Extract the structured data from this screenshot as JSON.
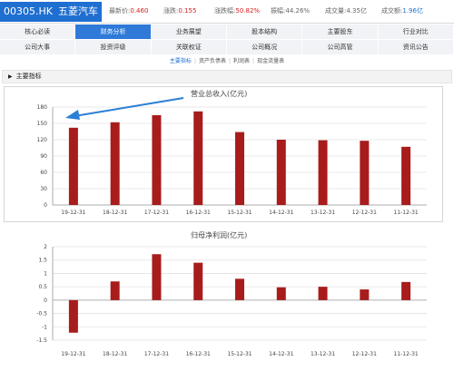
{
  "header": {
    "code": "00305.HK",
    "name": "五菱汽车",
    "quotes": [
      {
        "label": "最新价:",
        "value": "0.460",
        "color": "#d92020"
      },
      {
        "label": "涨跌:",
        "value": "0.155",
        "color": "#d92020"
      },
      {
        "label": "涨跌幅:",
        "value": "50.82%",
        "color": "#d92020"
      },
      {
        "label": "振幅:",
        "value": "44.26%",
        "color": "#666666"
      },
      {
        "label": "成交量:",
        "value": "4.35亿",
        "color": "#666666"
      },
      {
        "label": "成交额:",
        "value": "1.96亿",
        "color": "#1f6fd1"
      }
    ]
  },
  "tabs": {
    "row1": [
      "核心必读",
      "财务分析",
      "业务展望",
      "股本结构",
      "主要股东",
      "行业对比"
    ],
    "row2": [
      "公司大事",
      "投资评级",
      "关联权证",
      "公司概况",
      "公司高管",
      "资讯公告"
    ],
    "active": "财务分析"
  },
  "subtabs": [
    "主要指标",
    "资产负债表",
    "利润表",
    "现金流量表"
  ],
  "section": {
    "title": "主要指标"
  },
  "chart_data": [
    {
      "type": "bar",
      "title": "营业总收入(亿元)",
      "categories": [
        "19-12-31",
        "18-12-31",
        "17-12-31",
        "16-12-31",
        "15-12-31",
        "14-12-31",
        "13-12-31",
        "12-12-31",
        "11-12-31"
      ],
      "values": [
        142,
        152,
        165,
        172,
        134,
        120,
        119,
        118,
        107
      ],
      "ylim": [
        0,
        180
      ],
      "yticks": [
        "0",
        "30",
        "60",
        "90",
        "120",
        "150",
        "180"
      ],
      "grid": true,
      "color": "#a81c1c",
      "annotation": "arrow"
    },
    {
      "type": "bar",
      "title": "归母净利润(亿元)",
      "categories": [
        "19-12-31",
        "18-12-31",
        "17-12-31",
        "16-12-31",
        "15-12-31",
        "14-12-31",
        "13-12-31",
        "12-12-31",
        "11-12-31"
      ],
      "values": [
        -1.22,
        0.7,
        1.72,
        1.4,
        0.8,
        0.48,
        0.5,
        0.4,
        0.68
      ],
      "ylim": [
        -1.5,
        2
      ],
      "yticks": [
        "-1.5",
        "-1",
        "-0.5",
        "0",
        "0.5",
        "1",
        "1.5",
        "2"
      ],
      "grid": true,
      "color": "#a81c1c"
    }
  ],
  "colors": {
    "accent": "#1f6fd1",
    "bar": "#a81c1c",
    "arrow": "#2a7fd4"
  }
}
